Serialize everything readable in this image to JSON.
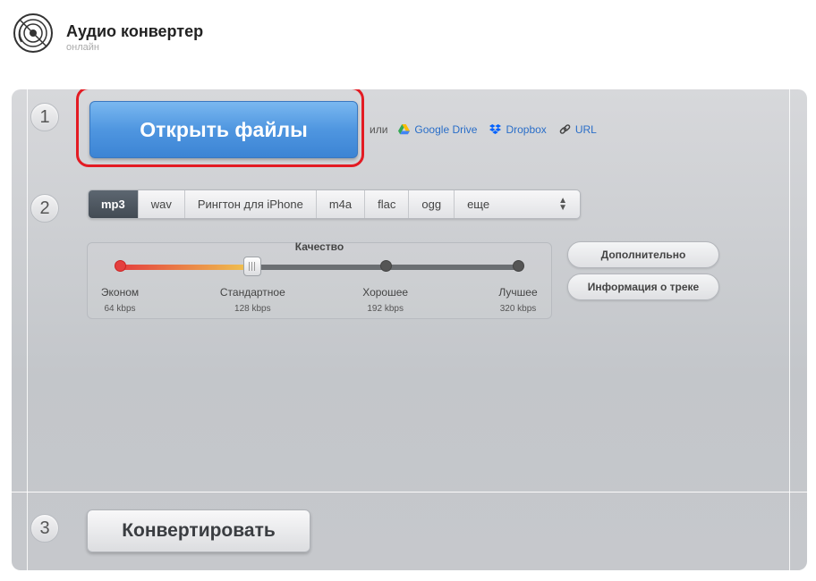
{
  "header": {
    "title": "Аудио конвертер",
    "subtitle": "онлайн",
    "logo_icon": "disc-icon"
  },
  "steps": [
    "1",
    "2",
    "3"
  ],
  "open": {
    "button_label": "Открыть файлы",
    "or_label": "или",
    "sources": [
      {
        "label": "Google Drive",
        "icon": "google-drive-icon"
      },
      {
        "label": "Dropbox",
        "icon": "dropbox-icon"
      },
      {
        "label": "URL",
        "icon": "link-icon"
      }
    ]
  },
  "formats": {
    "items": [
      "mp3",
      "wav",
      "Рингтон для iPhone",
      "m4a",
      "flac",
      "ogg"
    ],
    "more_label": "еще",
    "selected": "mp3"
  },
  "quality": {
    "title": "Качество",
    "selected_index": 1,
    "levels": [
      {
        "label": "Эконом",
        "kbps": "64 kbps"
      },
      {
        "label": "Стандартное",
        "kbps": "128 kbps"
      },
      {
        "label": "Хорошее",
        "kbps": "192 kbps"
      },
      {
        "label": "Лучшее",
        "kbps": "320 kbps"
      }
    ]
  },
  "side_buttons": {
    "advanced": "Дополнительно",
    "track_info": "Информация о треке"
  },
  "convert": {
    "button_label": "Конвертировать"
  },
  "colors": {
    "accent_blue": "#4f96e0",
    "highlight_red": "#e31b23",
    "quality_low": "#e43f3f",
    "quality_mid": "#f0c850"
  }
}
